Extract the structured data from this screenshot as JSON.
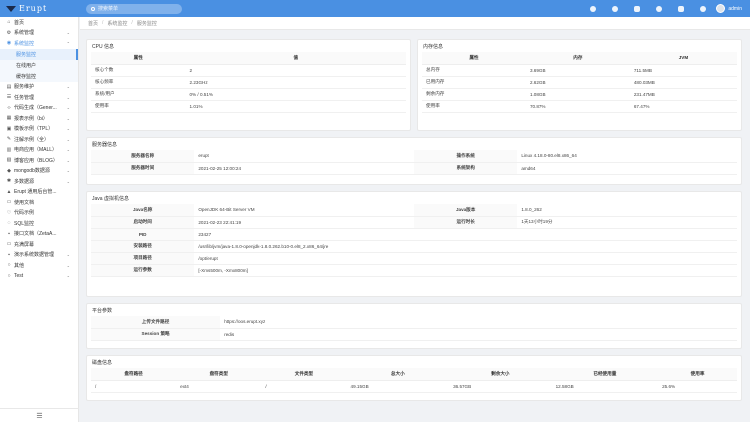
{
  "header": {
    "brand": "Erupt",
    "search_placeholder": "搜索菜单",
    "user_name": "admin"
  },
  "sidebar": {
    "items": [
      {
        "icon": "home-icon",
        "glyph": "⌂",
        "label": "首页"
      },
      {
        "icon": "gear-icon",
        "glyph": "⚙",
        "label": "系统管理",
        "arrow": "⌄"
      },
      {
        "icon": "monitor-icon",
        "glyph": "◉",
        "label": "系统监控",
        "arrow": "⌃"
      }
    ],
    "subitems": [
      "服务监控",
      "在线用户",
      "缓存监控"
    ],
    "items2": [
      {
        "icon": "wrench-icon",
        "glyph": "▤",
        "label": "服务维护",
        "arrow": "⌄"
      },
      {
        "icon": "tasks-icon",
        "glyph": "☰",
        "label": "任务管理",
        "arrow": "⌄"
      },
      {
        "icon": "code-icon",
        "glyph": "‹›",
        "label": "代码生成（Gener...",
        "arrow": "⌄"
      },
      {
        "icon": "report-icon",
        "glyph": "▦",
        "label": "报表示例（bi）",
        "arrow": "⌄"
      },
      {
        "icon": "template-icon",
        "glyph": "▣",
        "label": "模板示例（TPL）",
        "arrow": "⌄"
      },
      {
        "icon": "annotation-icon",
        "glyph": "✎",
        "label": "注解示例（全）",
        "arrow": "⌄"
      },
      {
        "icon": "shop-icon",
        "glyph": "▥",
        "label": "电商应用（MALL）",
        "arrow": "⌄"
      },
      {
        "icon": "blog-icon",
        "glyph": "▧",
        "label": "博客应用（BLOG）",
        "arrow": "⌄"
      },
      {
        "icon": "mongodb-icon",
        "glyph": "◆",
        "label": "mongodb数据源",
        "arrow": "⌄"
      },
      {
        "icon": "datasource-icon",
        "glyph": "✱",
        "label": "多数据源",
        "arrow": "⌄"
      },
      {
        "icon": "erupt-icon",
        "glyph": "▲",
        "label": "Erupt 通用后台管..."
      },
      {
        "icon": "doc-icon",
        "glyph": "▭",
        "label": "使用文档"
      },
      {
        "icon": "heart-icon",
        "glyph": "♡",
        "label": "代码示例"
      },
      {
        "icon": "sql-icon",
        "glyph": "◌",
        "label": "SQL监控"
      },
      {
        "icon": "api-icon",
        "glyph": "▪",
        "label": "接口文档（ZetaA..."
      },
      {
        "icon": "fullscreen-icon",
        "glyph": "▭",
        "label": "充满屏幕"
      },
      {
        "icon": "demo-icon",
        "glyph": "▪",
        "label": "演示系统数据管理",
        "arrow": "⌄"
      },
      {
        "icon": "other-icon",
        "glyph": "○",
        "label": "其他",
        "arrow": "⌄"
      },
      {
        "icon": "test-icon",
        "glyph": "○",
        "label": "Test",
        "arrow": "⌄"
      }
    ],
    "collapse_glyph": "☰"
  },
  "breadcrumb": [
    "首页",
    "系统监控",
    "服务监控"
  ],
  "cpu": {
    "title": "CPU 信息",
    "headers": [
      "属性",
      "值"
    ],
    "rows": [
      [
        "核心个数",
        "2"
      ],
      [
        "核心频率",
        "2.23GHz"
      ],
      [
        "系统/用户",
        "0% / 0.51%"
      ],
      [
        "使用率",
        "1.01%"
      ]
    ]
  },
  "memory": {
    "title": "内存信息",
    "headers": [
      "属性",
      "内存",
      "JVM"
    ],
    "rows": [
      [
        "总内存",
        "3.69GB",
        "711.5MB"
      ],
      [
        "已用内存",
        "2.62GB",
        "480.03MB"
      ],
      [
        "剩余内存",
        "1.08GB",
        "231.47MB"
      ],
      [
        "使用率",
        "70.87%",
        "67.47%"
      ]
    ]
  },
  "server": {
    "title": "服务器信息",
    "rows": [
      [
        "服务器名称",
        "erupt",
        "操作系统",
        "Linux 4.18.0-80.el8.x86_64"
      ],
      [
        "服务器时间",
        "2021-02-25 12:00:24",
        "系统架构",
        "amd64"
      ]
    ]
  },
  "jvm": {
    "title": "Java 虚拟机信息",
    "row1": [
      "Java名称",
      "OpenJDK 64-Bit Server VM",
      "Java版本",
      "1.8.0_262"
    ],
    "row2": [
      "启动时间",
      "2021-02-23 22:41:19",
      "运行时长",
      "1天13小时19分"
    ],
    "rows": [
      [
        "PID",
        "23427"
      ],
      [
        "安装路径",
        "/usr/lib/jvm/java-1.8.0-openjdk-1.8.0.262.b10-0.el8_2.x86_64/jre"
      ],
      [
        "项目路径",
        "/opt/erupt"
      ],
      [
        "运行参数",
        "[-Xms500m, -Xmx800m]"
      ]
    ]
  },
  "platform": {
    "title": "平台参数",
    "rows": [
      [
        "上传文件路径",
        "https://oos.erupt.xyz"
      ],
      [
        "Session 策略",
        "redis"
      ]
    ]
  },
  "disk": {
    "title": "磁盘信息",
    "headers": [
      "盘符路径",
      "盘符类型",
      "文件类型",
      "总大小",
      "剩余大小",
      "已经使用量",
      "使用率"
    ],
    "rows": [
      [
        "/",
        "ext4",
        "/",
        "49.15GB",
        "36.57GB",
        "12.58GB",
        "25.6%"
      ]
    ]
  },
  "colors": {
    "primary": "#4a90e2",
    "header_bg": "#4a90e2"
  }
}
